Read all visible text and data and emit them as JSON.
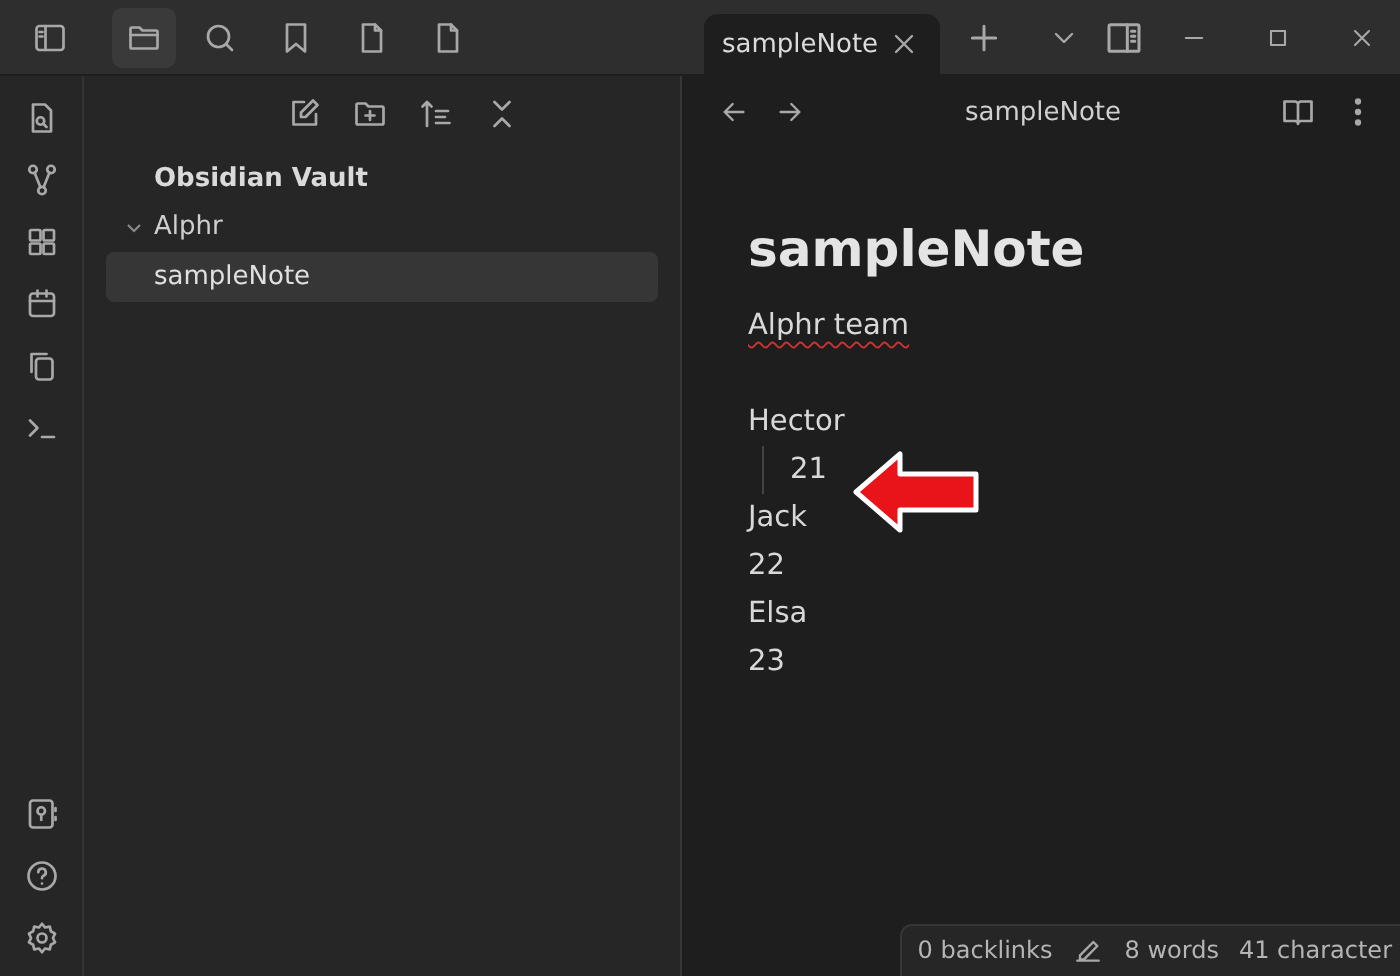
{
  "tabs": [
    {
      "title": "sampleNote",
      "selected": true
    }
  ],
  "file_explorer": {
    "vault": "Obsidian Vault",
    "folders": [
      {
        "name": "Alphr",
        "expanded": true,
        "children": [
          {
            "name": "sampleNote",
            "selected": true
          }
        ]
      }
    ]
  },
  "note": {
    "header_title": "sampleNote",
    "title": "sampleNote",
    "paragraphs": [
      {
        "lines": [
          {
            "text": "Alphr team",
            "kind": "misspelled"
          }
        ]
      },
      {
        "lines": [
          {
            "text": "Hector",
            "kind": "plain"
          },
          {
            "text": "21",
            "kind": "indented"
          },
          {
            "text": "Jack",
            "kind": "plain"
          },
          {
            "text": "22",
            "kind": "plain"
          },
          {
            "text": "Elsa",
            "kind": "plain"
          },
          {
            "text": "23",
            "kind": "plain"
          }
        ]
      }
    ]
  },
  "status_bar": {
    "backlinks": "0 backlinks",
    "words": "8 words",
    "characters": "41 character"
  }
}
